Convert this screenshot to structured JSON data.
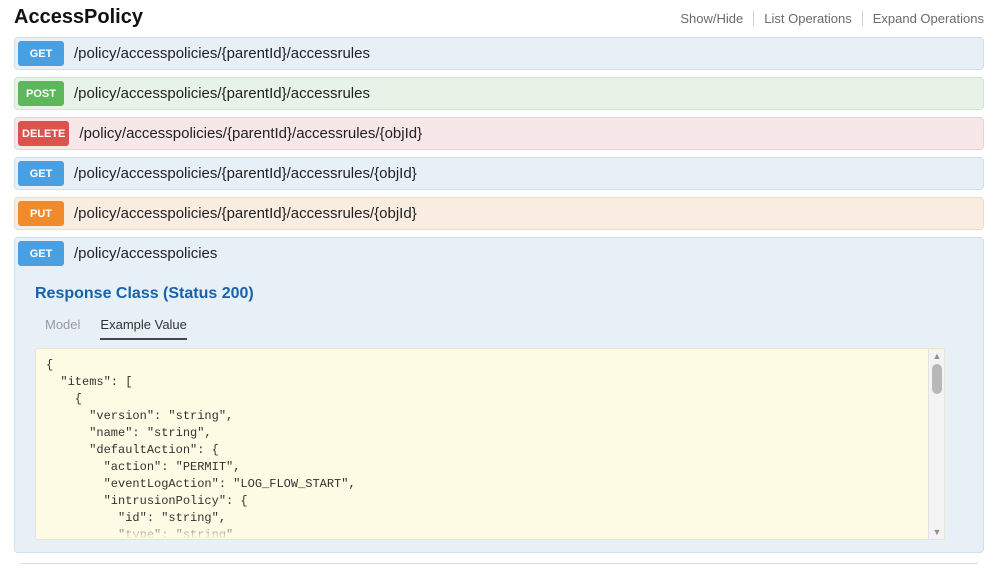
{
  "header": {
    "title": "AccessPolicy",
    "ops": [
      "Show/Hide",
      "List Operations",
      "Expand Operations"
    ]
  },
  "endpoints": [
    {
      "method": "GET",
      "path": "/policy/accesspolicies/{parentId}/accessrules"
    },
    {
      "method": "POST",
      "path": "/policy/accesspolicies/{parentId}/accessrules"
    },
    {
      "method": "DELETE",
      "path": "/policy/accesspolicies/{parentId}/accessrules/{objId}"
    },
    {
      "method": "GET",
      "path": "/policy/accesspolicies/{parentId}/accessrules/{objId}"
    },
    {
      "method": "PUT",
      "path": "/policy/accesspolicies/{parentId}/accessrules/{objId}"
    }
  ],
  "expanded": {
    "method": "GET",
    "path": "/policy/accesspolicies",
    "responseTitle": "Response Class (Status 200)",
    "tabs": {
      "model": "Model",
      "example": "Example Value"
    },
    "code": "{\n  \"items\": [\n    {\n      \"version\": \"string\",\n      \"name\": \"string\",\n      \"defaultAction\": {\n        \"action\": \"PERMIT\",\n        \"eventLogAction\": \"LOG_FLOW_START\",\n        \"intrusionPolicy\": {\n          \"id\": \"string\",\n          \"type\": \"string\""
  }
}
